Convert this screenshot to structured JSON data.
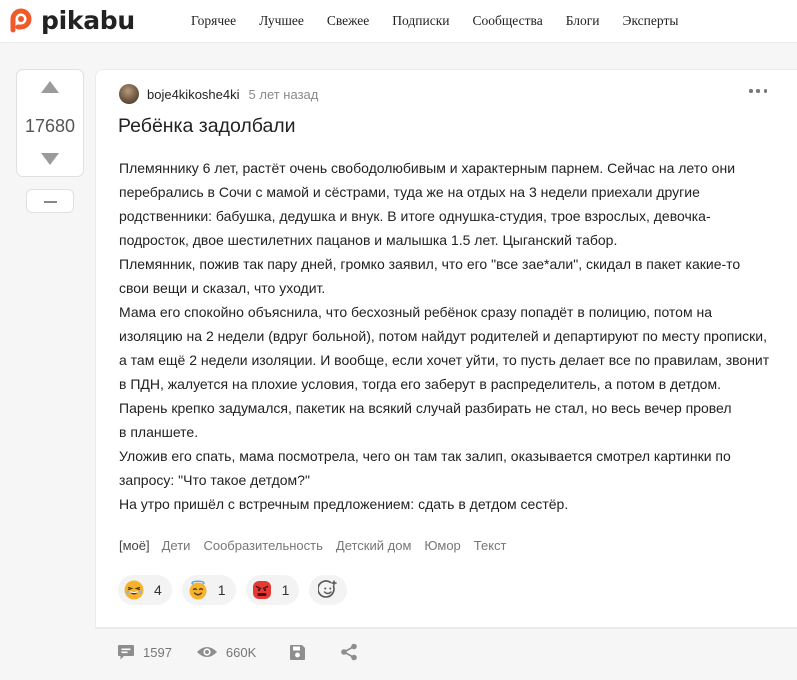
{
  "header": {
    "logo_text": "pikabu",
    "nav": [
      "Горячее",
      "Лучшее",
      "Свежее",
      "Подписки",
      "Сообщества",
      "Блоги",
      "Эксперты"
    ]
  },
  "vote": {
    "rating": "17680"
  },
  "post": {
    "author": "boje4kikoshe4ki",
    "time": "5 лет назад",
    "title": "Ребёнка задолбали",
    "lines": [
      "Племяннику 6 лет, растёт очень свободолюбивым и характерным парнем. Сейчас на лето они",
      "перебрались в Сочи с мамой и сёстрами, туда же на отдых на 3 недели приехали другие",
      "родственники: бабушка, дедушка и внук. В итоге однушка-студия, трое взрослых, девочка-",
      "подросток, двое шестилетних пацанов и малышка 1.5 лет.  Цыганский табор.",
      "Племянник, пожив так пару дней, громко заявил, что его \"все зае*али\", скидал в пакет какие-то",
      "свои вещи и сказал, что уходит.",
      "Мама его спокойно объяснила, что бесхозный ребёнок сразу попадёт в полицию, потом на",
      "изоляцию на 2 недели (вдруг больной), потом найдут родителей и департируют по месту прописки,",
      "а там ещё 2 недели изоляции. И вообще, если хочет уйти, то пусть делает все по правилам, звонит",
      "в ПДН, жалуется на плохие условия, тогда его заберут в распределитель, а потом в детдом.",
      "Парень крепко задумался, пакетик на всякий случай разбирать не стал, но весь вечер провел",
      "в планшете.",
      "Уложив его спать, мама посмотрела, чего он там так залип, оказывается смотрел картинки по",
      "запросу: \"Что такое детдом?\"",
      "На утро пришёл с встречным предложением: сдать в детдом сестёр."
    ],
    "tags": [
      "[моё]",
      "Дети",
      "Сообразительность",
      "Детский дом",
      "Юмор",
      "Текст"
    ],
    "reactions": [
      {
        "icon": "laughing-face",
        "count": "4"
      },
      {
        "icon": "angel-face",
        "count": "1"
      },
      {
        "icon": "angry-face",
        "count": "1"
      }
    ],
    "add_reaction_icon": "add-reaction-smiley"
  },
  "stats": {
    "comments": "1597",
    "views": "660K"
  },
  "colors": {
    "brand": "#f05a28",
    "text": "#222222",
    "muted": "#8a8a8a"
  }
}
